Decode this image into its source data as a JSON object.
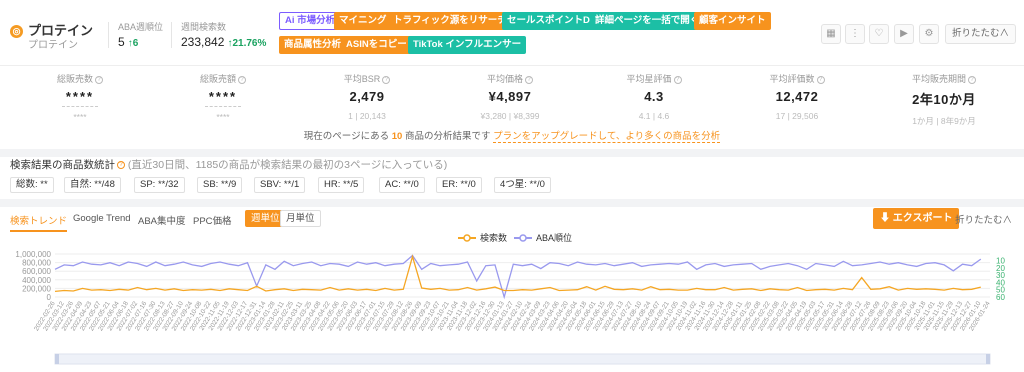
{
  "keyword": {
    "title": "プロテイン",
    "subtitle": "プロテイン",
    "icon": "keyword-badge-icon"
  },
  "aba": {
    "label": "ABA週順位",
    "value": "5",
    "delta": "↑6"
  },
  "weekly_search": {
    "label": "週間検索数",
    "value": "233,842",
    "delta": "↑21.76%"
  },
  "tools": {
    "row1": [
      "市場分析",
      "マイニング",
      "トラフィック源をリサーチ",
      "セールスポイントDL",
      "詳細ページを一括で開く",
      "顧客インサイト"
    ],
    "row2": [
      "商品属性分析",
      "ASINをコピー",
      "TikTok インフルエンサー"
    ],
    "ai_prefix": "Ai"
  },
  "icons": [
    "grid-icon",
    "more-icon",
    "heart-icon",
    "video-icon",
    "settings-icon"
  ],
  "collapse_top": "折りたたむ∧",
  "metrics": [
    {
      "label": "総販売数",
      "value": "****",
      "sub": "****"
    },
    {
      "label": "総販売額",
      "value": "****",
      "sub": "****"
    },
    {
      "label": "平均BSR",
      "value": "2,479",
      "sub": "1 | 20,143"
    },
    {
      "label": "平均価格",
      "value": "¥4,897",
      "sub": "¥3,280 | ¥8,399"
    },
    {
      "label": "平均星評価",
      "value": "4.3",
      "sub": "4.1 | 4.6"
    },
    {
      "label": "平均評価数",
      "value": "12,472",
      "sub": "17 | 29,506"
    },
    {
      "label": "平均販売期間",
      "value": "2年10か月",
      "sub": "1か月 | 8年9か月"
    }
  ],
  "upgrade": {
    "prefix": "現在のページにある",
    "count": "10",
    "suffix": "商品の分析結果です",
    "link": "プランをアップグレードして、より多くの商品を分析"
  },
  "count_section": {
    "title": "検索結果の商品数統計",
    "note": "(直近30日間、1185の商品が検索結果の最初の3ページに入っている)"
  },
  "chips": [
    "総数: **",
    "自然: **/48",
    "SP: **/32",
    "SB: **/9",
    "SBV: **/1",
    "HR: **/5",
    "AC: **/0",
    "ER: **/0",
    "4つ星: **/0"
  ],
  "tabs": [
    "検索トレンド",
    "Google Trend",
    "ABA集中度",
    "PPC価格"
  ],
  "period": [
    "週単位",
    "月単位"
  ],
  "export_label": "エクスポート",
  "collapse_chart": "折りたたむ∧",
  "chart_data": {
    "type": "line",
    "legend_position": "top-center",
    "grid": true,
    "colors": {
      "search": "#f5a623",
      "rank": "#9999ee"
    },
    "y_left": {
      "ticks": [
        "0",
        "200,000",
        "400,000",
        "600,000",
        "800,000",
        "1,000,000"
      ],
      "range": [
        0,
        1000000
      ]
    },
    "y_right": {
      "ticks": [
        "10",
        "20",
        "30",
        "40",
        "50",
        "60"
      ],
      "range": [
        1,
        60
      ],
      "reversed": true
    },
    "x_dates": [
      "2022-02-26",
      "2022-03-12",
      "2022-03-26",
      "2022-04-09",
      "2022-04-23",
      "2022-05-07",
      "2022-05-21",
      "2022-06-04",
      "2022-06-18",
      "2022-07-02",
      "2022-07-16",
      "2022-07-30",
      "2022-08-13",
      "2022-08-27",
      "2022-09-10",
      "2022-09-24",
      "2022-10-08",
      "2022-10-22",
      "2022-11-05",
      "2022-11-19",
      "2022-12-03",
      "2022-12-17",
      "2022-12-31",
      "2023-01-14",
      "2023-01-28",
      "2023-02-11",
      "2023-02-25",
      "2023-03-11",
      "2023-03-25",
      "2023-04-08",
      "2023-04-22",
      "2023-05-06",
      "2023-05-20",
      "2023-06-03",
      "2023-06-17",
      "2023-07-01",
      "2023-07-15",
      "2023-07-29",
      "2023-08-12",
      "2023-08-26",
      "2023-09-09",
      "2023-09-23",
      "2023-10-07",
      "2023-10-21",
      "2023-11-04",
      "2023-11-18",
      "2023-12-02",
      "2023-12-16",
      "2023-12-30",
      "2024-01-13",
      "2024-01-27",
      "2024-02-10",
      "2024-02-24",
      "2024-03-09",
      "2024-03-23",
      "2024-04-06",
      "2024-04-20",
      "2024-05-04",
      "2024-05-18",
      "2024-06-01",
      "2024-06-15",
      "2024-06-29",
      "2024-07-13",
      "2024-07-27",
      "2024-08-10",
      "2024-08-24",
      "2024-09-07",
      "2024-09-21",
      "2024-10-05",
      "2024-10-19",
      "2024-11-02",
      "2024-11-16",
      "2024-11-30",
      "2024-12-14",
      "2024-12-28",
      "2025-01-11",
      "2025-01-25",
      "2025-02-08",
      "2025-02-22",
      "2025-03-08",
      "2025-03-22",
      "2025-04-05",
      "2025-04-19",
      "2025-05-03",
      "2025-05-17",
      "2025-05-31",
      "2025-06-14",
      "2025-06-28",
      "2025-07-12",
      "2025-07-26",
      "2025-08-09",
      "2025-08-23",
      "2025-09-06",
      "2025-09-20",
      "2025-10-04",
      "2025-10-18",
      "2025-11-01",
      "2025-11-15",
      "2025-11-29",
      "2025-12-13",
      "2025-12-27",
      "2026-01-10",
      "2026-01-24"
    ],
    "series": [
      {
        "name": "検索数",
        "axis": "left",
        "values": [
          130000,
          150000,
          140000,
          200000,
          160000,
          170000,
          150000,
          180000,
          160000,
          220000,
          170000,
          200000,
          160000,
          190000,
          150000,
          170000,
          160000,
          180000,
          150000,
          190000,
          170000,
          150000,
          250000,
          140000,
          170000,
          190000,
          150000,
          180000,
          170000,
          160000,
          220000,
          160000,
          190000,
          160000,
          180000,
          150000,
          200000,
          160000,
          180000,
          940000,
          210000,
          180000,
          200000,
          160000,
          170000,
          220000,
          160000,
          190000,
          230000,
          150000,
          150000,
          170000,
          160000,
          190000,
          220000,
          150000,
          160000,
          170000,
          240000,
          160000,
          250000,
          180000,
          170000,
          190000,
          160000,
          240000,
          170000,
          180000,
          160000,
          160000,
          200000,
          170000,
          170000,
          220000,
          160000,
          180000,
          190000,
          150000,
          190000,
          170000,
          160000,
          220000,
          150000,
          170000,
          180000,
          160000,
          200000,
          170000,
          450000,
          180000,
          190000,
          240000,
          160000,
          200000,
          180000,
          190000,
          180000,
          160000,
          200000,
          170000,
          180000,
          230000
        ]
      },
      {
        "name": "ABA順位",
        "axis": "right",
        "values": [
          22,
          16,
          17,
          12,
          15,
          16,
          13,
          17,
          12,
          14,
          18,
          12,
          17,
          15,
          12,
          16,
          18,
          14,
          12,
          15,
          17,
          13,
          45,
          16,
          22,
          11,
          17,
          14,
          12,
          17,
          14,
          15,
          18,
          12,
          15,
          13,
          17,
          15,
          14,
          3,
          22,
          14,
          17,
          16,
          15,
          12,
          38,
          17,
          16,
          60,
          15,
          17,
          15,
          21,
          13,
          14,
          17,
          12,
          15,
          16,
          14,
          17,
          15,
          13,
          18,
          16,
          15,
          14,
          15,
          12,
          22,
          16,
          14,
          18,
          16,
          15,
          14,
          22,
          18,
          16,
          14,
          17,
          22,
          14,
          16,
          18,
          11,
          17,
          16,
          14,
          12,
          15,
          13,
          16,
          18,
          14,
          13,
          16,
          24,
          15,
          17,
          8
        ]
      }
    ]
  }
}
